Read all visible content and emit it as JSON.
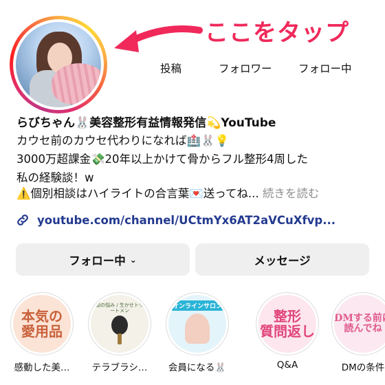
{
  "annotation": {
    "text": "ここをタップ",
    "color": "#f0295a"
  },
  "stats": {
    "posts_label": "投稿",
    "followers_label": "フォロワー",
    "following_label": "フォロー中"
  },
  "profile": {
    "name": "らびちゃん🐰美容整形有益情報発信💫YouTube",
    "bio": [
      "カウセ前のカウセ代わりになれば🏥🐰💡",
      "3000万超課金💸20年以上かけて骨からフル整形4周した",
      "私の経験談！w",
      "⚠️個別相談はハイライトの合言葉💌送ってね..."
    ],
    "more_label": "続きを読む",
    "link": "youtube.com/channel/UCtmYx6AT2aVCuXfvp..."
  },
  "buttons": {
    "following": "フォロー中",
    "message": "メッセージ"
  },
  "highlights": [
    {
      "label": "感動した美…",
      "cover_text": "本気の\n愛用品",
      "icon": "beauty-products-cover"
    },
    {
      "label": "テラブラシ…",
      "cover_text": "頭の悩み / 生かせトリートメン",
      "icon": "hair-brush-cover"
    },
    {
      "label": "会員になる🐰",
      "cover_text": "オンラインサロン",
      "icon": "online-salon-cover"
    },
    {
      "label": "Q&A",
      "cover_text": "整形\n質問返し",
      "icon": "qa-cover"
    },
    {
      "label": "DMの条件",
      "cover_text": "DMする前に\n読んでね",
      "icon": "dm-rules-cover"
    }
  ],
  "colors": {
    "link": "#233a8f",
    "button_bg": "#efefef",
    "accent": "#f0295a"
  }
}
